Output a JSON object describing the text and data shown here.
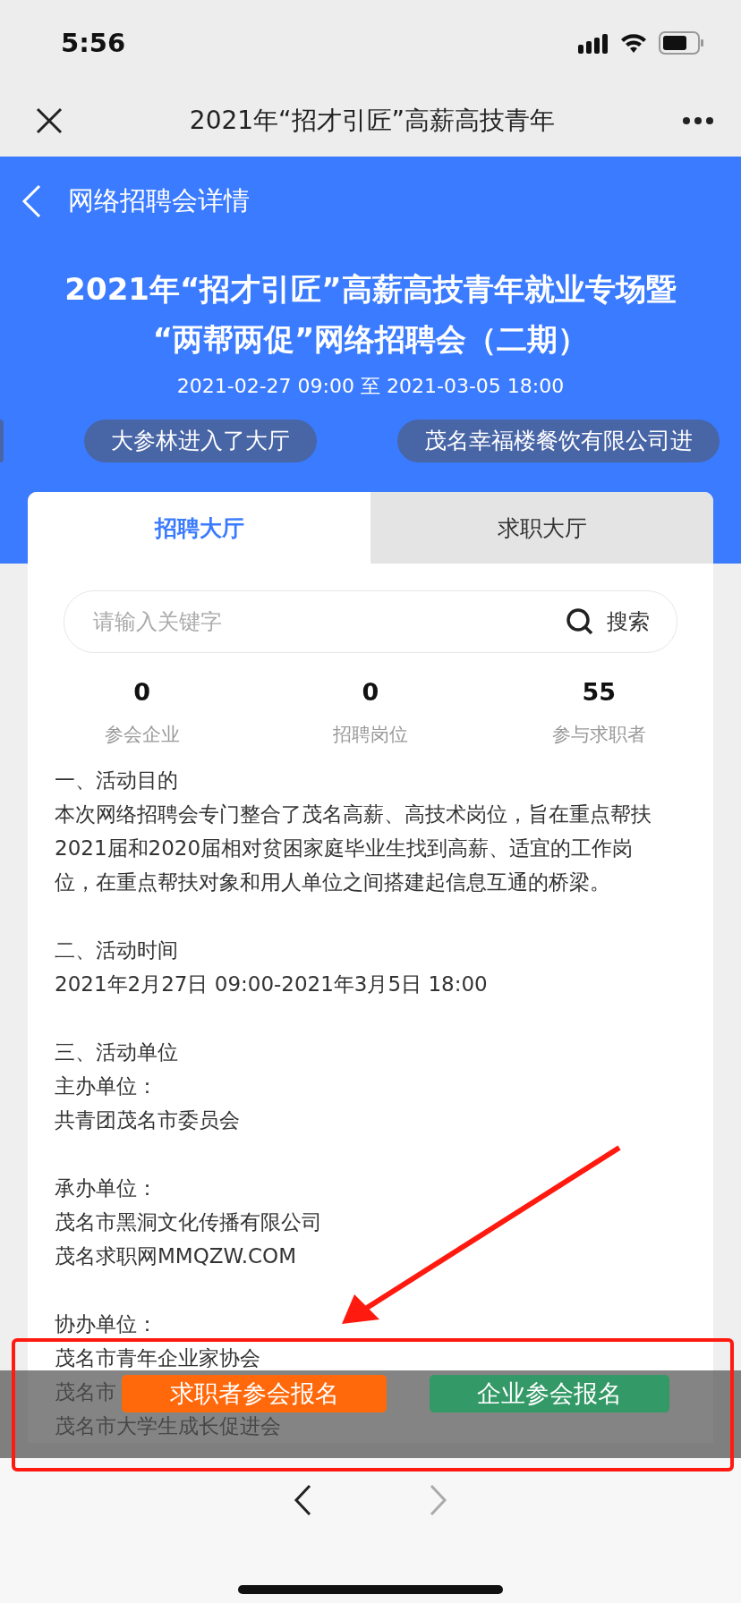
{
  "status_bar": {
    "time": "5:56"
  },
  "nav_bar": {
    "title": "2021年“招才引匠”高薪高技青年"
  },
  "header": {
    "back_label": "网络招聘会详情",
    "title_lines": [
      "2021年“招才引匠”高薪高技青年就业专场暨",
      "“两帮两促”网络招聘会（二期）"
    ],
    "date_range": "2021-02-27 09:00 至 2021-03-05 18:00"
  },
  "ticker": [
    "大参林进入了大厅",
    "茂名幸福楼餐饮有限公司进"
  ],
  "tabs": [
    {
      "label": "招聘大厅",
      "selected": true
    },
    {
      "label": "求职大厅",
      "selected": false
    }
  ],
  "search": {
    "placeholder": "请输入关键字",
    "button": "搜索"
  },
  "stats": [
    {
      "value": "0",
      "label": "参会企业"
    },
    {
      "value": "0",
      "label": "招聘岗位"
    },
    {
      "value": "55",
      "label": "参与求职者"
    }
  ],
  "description": [
    {
      "lines": [
        "一、活动目的",
        "本次网络招聘会专门整合了茂名高薪、高技术岗位，旨在重点帮扶2021届和2020届相对贫困家庭毕业生找到高薪、适宜的工作岗位，在重点帮扶对象和用人单位之间搭建起信息互通的桥梁。"
      ]
    },
    {
      "lines": [
        "二、活动时间",
        "2021年2月27日 09:00-2021年3月5日 18:00"
      ]
    },
    {
      "lines": [
        "三、活动单位",
        "主办单位：",
        "共青团茂名市委员会"
      ]
    },
    {
      "lines": [
        "承办单位：",
        "茂名市黑洞文化传播有限公司",
        "茂名求职网MMQZW.COM"
      ]
    },
    {
      "lines": [
        "协办单位：",
        "茂名市青年企业家协会",
        "茂名市",
        "茂名市大学生成长促进会"
      ]
    }
  ],
  "action_buttons": [
    {
      "label": "求职者参会报名",
      "kind": "primary"
    },
    {
      "label": "企业参会报名",
      "kind": "secondary"
    }
  ]
}
